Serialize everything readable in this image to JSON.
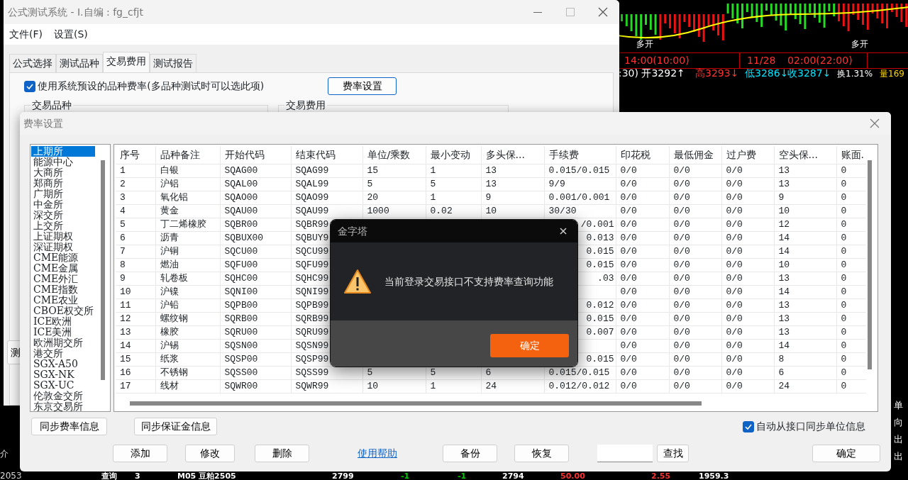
{
  "background": {
    "time_labels": [
      "14:00(10:00)",
      "11/28",
      "02:00(22:00)"
    ],
    "quote": [
      {
        "text": ":30) 开3292↑",
        "color": "#ffffff"
      },
      {
        "text": "高3293↓",
        "color": "#ff3232"
      },
      {
        "text": "低3286↓",
        "color": "#00e5ff"
      },
      {
        "text": "收3287↓",
        "color": "#00e5ff"
      },
      {
        "text": "换1.31%",
        "color": "#ffffff"
      },
      {
        "text": "量169",
        "color": "#ffd700"
      }
    ],
    "signals": [
      "多开",
      "多开"
    ],
    "side_labels": [
      "单",
      "向",
      "出",
      "出"
    ],
    "left_labels": [
      "介",
      "2053"
    ],
    "bottom_row": [
      {
        "text": "查询",
        "color": "#ffffff"
      },
      {
        "text": "3",
        "color": "#ffffff"
      },
      {
        "text": "M05 豆粕2505",
        "color": "#ffffff"
      },
      {
        "text": "2799",
        "color": "#ffffff"
      },
      {
        "text": "-1",
        "color": "#00d000"
      },
      {
        "text": "-1",
        "color": "#00d000"
      },
      {
        "text": "2794",
        "color": "#ffffff"
      },
      {
        "text": "50.00",
        "color": "#ff3232"
      },
      {
        "text": "2.55",
        "color": "#ff3232"
      },
      {
        "text": "1959.3",
        "color": "#ffffff"
      }
    ]
  },
  "main_window": {
    "title": "公式测试系统 - I.自编 : fg_cfjt",
    "menu": [
      "文件(F)",
      "设置(S)"
    ],
    "tabs": [
      {
        "label": "公式选择",
        "selected": false
      },
      {
        "label": "测试品种",
        "selected": false
      },
      {
        "label": "交易费用",
        "selected": true
      },
      {
        "label": "测试报告",
        "selected": false
      }
    ],
    "use_preset": {
      "label": "使用系统预设的品种费率(多品种测试时可以选此项)",
      "checked": true
    },
    "rate_button": "费率设置",
    "groups": [
      "交易品种",
      "交易费用"
    ],
    "cut_button": "测"
  },
  "rate_dialog": {
    "title": "费率设置",
    "exchanges": [
      {
        "label": "上期所",
        "selected": true
      },
      {
        "label": "能源中心",
        "selected": false
      },
      {
        "label": "大商所",
        "selected": false
      },
      {
        "label": "郑商所",
        "selected": false
      },
      {
        "label": "广期所",
        "selected": false
      },
      {
        "label": "中金所",
        "selected": false
      },
      {
        "label": "深交所",
        "selected": false
      },
      {
        "label": "上交所",
        "selected": false
      },
      {
        "label": "上证期权",
        "selected": false
      },
      {
        "label": "深证期权",
        "selected": false
      },
      {
        "label": "CME能源",
        "selected": false
      },
      {
        "label": "CME金属",
        "selected": false
      },
      {
        "label": "CME外汇",
        "selected": false
      },
      {
        "label": "CME指数",
        "selected": false
      },
      {
        "label": "CME农业",
        "selected": false
      },
      {
        "label": "CBOE权交所",
        "selected": false
      },
      {
        "label": "ICE欧洲",
        "selected": false
      },
      {
        "label": "ICE美洲",
        "selected": false
      },
      {
        "label": "欧洲期交所",
        "selected": false
      },
      {
        "label": "港交所",
        "selected": false
      },
      {
        "label": "SGX-A50",
        "selected": false
      },
      {
        "label": "SGX-NK",
        "selected": false
      },
      {
        "label": "SGX-UC",
        "selected": false
      },
      {
        "label": "伦敦金交所",
        "selected": false
      },
      {
        "label": "东京交易所",
        "selected": false
      }
    ],
    "table": {
      "columns": [
        "序号",
        "品种备注",
        "开始代码",
        "结束代码",
        "单位/乘数",
        "最小变动",
        "多头保...",
        "手续费",
        "印花税",
        "最低佣金",
        "过户费",
        "空头保...",
        "账面."
      ],
      "rows": [
        {
          "covered": false,
          "cells": [
            "1",
            "白银",
            "SQAG00",
            "SQAG99",
            "15",
            "1",
            "13",
            "0.015/0.015",
            "0/0",
            "0/0",
            "0/0",
            "13",
            "0"
          ]
        },
        {
          "covered": false,
          "cells": [
            "2",
            "沪铝",
            "SQAL00",
            "SQAL99",
            "5",
            "5",
            "13",
            "9/9",
            "0/0",
            "0/0",
            "0/0",
            "13",
            "0"
          ]
        },
        {
          "covered": false,
          "cells": [
            "3",
            "氧化铝",
            "SQAO00",
            "SQAO99",
            "20",
            "1",
            "9",
            "0.001/0.001",
            "0/0",
            "0/0",
            "0/0",
            "9",
            "0"
          ]
        },
        {
          "covered": false,
          "cells": [
            "4",
            "黄金",
            "SQAU00",
            "SQAU99",
            "1000",
            "0.02",
            "10",
            "30/30",
            "0/0",
            "0/0",
            "0/0",
            "10",
            "0"
          ]
        },
        {
          "covered": true,
          "cells": [
            "5",
            "丁二烯橡胶",
            "SQBR00",
            "SQBR99",
            null,
            null,
            null,
            "/0.001",
            "0/0",
            "0/0",
            "0/0",
            "12",
            "0"
          ]
        },
        {
          "covered": true,
          "cells": [
            "6",
            "沥青",
            "SQBUX00",
            "SQBUY9",
            null,
            null,
            null,
            "0.013",
            "0/0",
            "0/0",
            "0/0",
            "14",
            "0"
          ]
        },
        {
          "covered": true,
          "cells": [
            "7",
            "沪铜",
            "SQCU00",
            "SQCU99",
            null,
            null,
            null,
            "0.015",
            "0/0",
            "0/0",
            "0/0",
            "14",
            "0"
          ]
        },
        {
          "covered": true,
          "cells": [
            "8",
            "燃油",
            "SQFU00",
            "SQFU99",
            null,
            null,
            null,
            "0.015",
            "0/0",
            "0/0",
            "0/0",
            "10",
            "0"
          ]
        },
        {
          "covered": true,
          "cells": [
            "9",
            "轧卷板",
            "SQHC00",
            "SQHC99",
            null,
            null,
            null,
            ".03",
            "0/0",
            "0/0",
            "0/0",
            "13",
            "0"
          ]
        },
        {
          "cells": [
            "10",
            "沪镍",
            "SQNI00",
            "SQNI99",
            null,
            null,
            null,
            null,
            "0/0",
            "0/0",
            "0/0",
            "14",
            "0"
          ]
        },
        {
          "covered": true,
          "cells": [
            "11",
            "沪铅",
            "SQPB00",
            "SQPB99",
            null,
            null,
            null,
            "0.012",
            "0/0",
            "0/0",
            "0/0",
            "13",
            "0"
          ]
        },
        {
          "covered": true,
          "cells": [
            "12",
            "螺纹钢",
            "SQRB00",
            "SQRB99",
            null,
            null,
            null,
            "0.015",
            "0/0",
            "0/0",
            "0/0",
            "13",
            "0"
          ]
        },
        {
          "covered": true,
          "cells": [
            "13",
            "橡胶",
            "SQRU00",
            "SQRU99",
            null,
            null,
            null,
            "0.007",
            "0/0",
            "0/0",
            "0/0",
            "13",
            "0"
          ]
        },
        {
          "cells": [
            "14",
            "沪锡",
            "SQSN00",
            "SQSN99",
            null,
            null,
            null,
            null,
            "0/0",
            "0/0",
            "0/0",
            "14",
            "0"
          ]
        },
        {
          "covered": true,
          "cells": [
            "15",
            "纸浆",
            "SQSP00",
            "SQSP99",
            null,
            null,
            null,
            "0.015",
            "0/0",
            "0/0",
            "0/0",
            "8",
            "0"
          ]
        },
        {
          "covered": false,
          "cells": [
            "16",
            "不锈钢",
            "SQSS00",
            "SQSS99",
            "5",
            "5",
            "6",
            "0.015/0.015",
            "0/0",
            "0/0",
            "0/0",
            "6",
            "0"
          ]
        },
        {
          "covered": false,
          "cells": [
            "17",
            "线材",
            "SQWR00",
            "SQWR99",
            "10",
            "1",
            "24",
            "0.012/0.012",
            "0/0",
            "0/0",
            "0/0",
            "24",
            "0"
          ]
        }
      ]
    },
    "sync_buttons": [
      "同步费率信息",
      "同步保证金信息"
    ],
    "auto_sync": {
      "label": "自动从接口同步单位信息",
      "checked": true
    },
    "actions": [
      {
        "label": "添加",
        "kind": "button"
      },
      {
        "label": "修改",
        "kind": "button"
      },
      {
        "label": "删除",
        "kind": "button"
      },
      {
        "label": "使用帮助",
        "kind": "link"
      },
      {
        "label": "备份",
        "kind": "button"
      },
      {
        "label": "恢复",
        "kind": "button"
      },
      {
        "kind": "field"
      },
      {
        "label": "查找",
        "kind": "button"
      }
    ],
    "ok_button": "确定"
  },
  "alert": {
    "title": "金字塔",
    "message": "当前登录交易接口不支持费率查询功能",
    "ok_button": "确定"
  }
}
